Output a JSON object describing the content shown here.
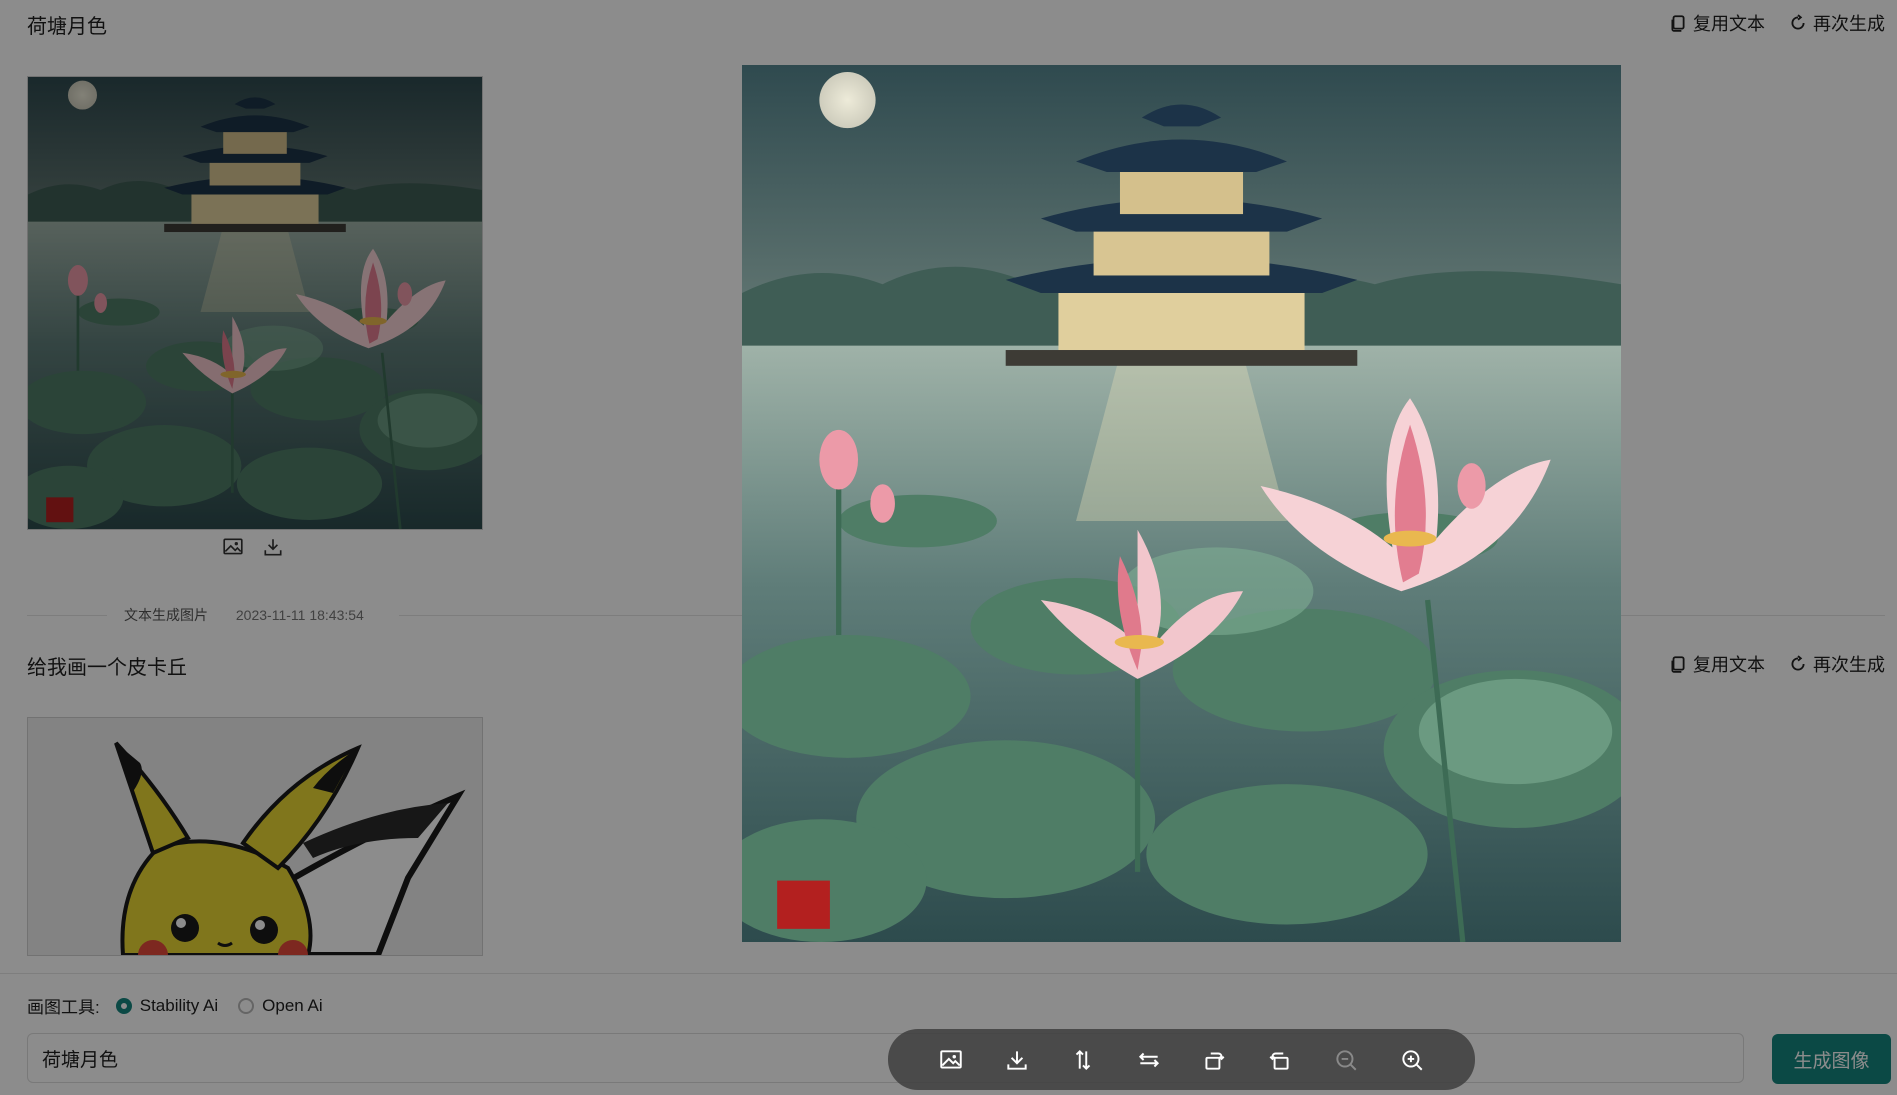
{
  "conversation": [
    {
      "prompt": "荷塘月色",
      "actions": {
        "copy_label": "复用文本",
        "regenerate_label": "再次生成"
      },
      "image_alt": "Lotus pond under the moon with a pagoda",
      "meta": {
        "type": "文本生成图片",
        "time": "2023-11-11 18:43:54"
      }
    },
    {
      "prompt": "给我画一个皮卡丘",
      "actions": {
        "copy_label": "复用文本",
        "regenerate_label": "再次生成"
      },
      "image_alt": "Pikachu illustration"
    }
  ],
  "composer": {
    "tool_label": "画图工具:",
    "options": [
      {
        "label": "Stability Ai",
        "selected": true
      },
      {
        "label": "Open Ai",
        "selected": false
      }
    ],
    "input_value": "荷塘月色",
    "submit_label": "生成图像"
  },
  "viewer": {
    "tools": [
      "image-icon",
      "download-icon",
      "flip-vertical-icon",
      "flip-horizontal-icon",
      "rotate-right-icon",
      "rotate-left-icon",
      "zoom-out-icon",
      "zoom-in-icon"
    ]
  },
  "colors": {
    "accent": "#14857f",
    "overlay": "rgba(0,0,0,0.45)"
  }
}
